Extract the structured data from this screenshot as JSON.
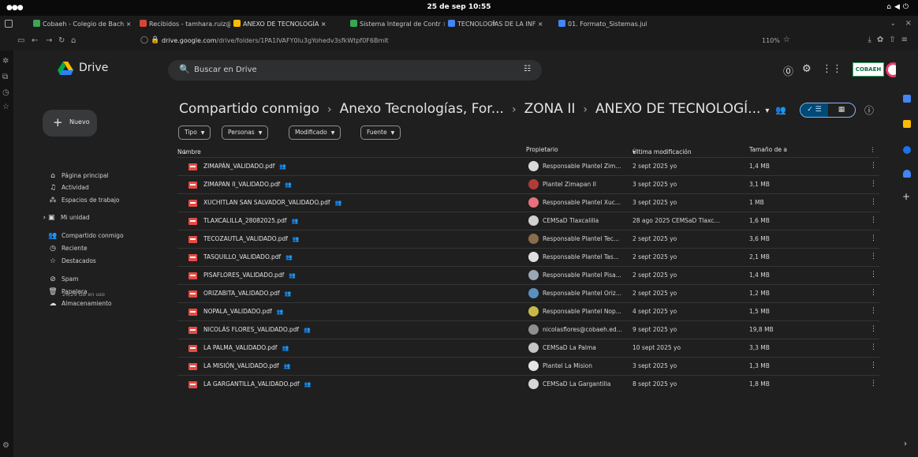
{
  "os": {
    "clock": "25 de sep  10:55"
  },
  "tabs": [
    {
      "label": "Cobaeh - Colegio de Bach ×",
      "color": "#3aa853"
    },
    {
      "label": "Recibidos - tamhara.ruiz@ ×",
      "color": "#d44638"
    },
    {
      "label": "ANEXO DE TECNOLOGÍA ×",
      "color": "#fbbc04"
    },
    {
      "label": "Sistema Integral de Contr ×",
      "color": "#34a853"
    },
    {
      "label": "TECNOLOGÍAS DE LA INF ×",
      "color": "#4285f4"
    },
    {
      "label": "01. Formato_Sistemas.jul ×",
      "color": "#4285f4"
    }
  ],
  "address": {
    "url_host": "drive.google.com",
    "url_path": "/drive/folders/1PA1IVAFY0lu3gYohedv3sfkWtpf0F6Bmlt",
    "zoom": "110%"
  },
  "drive": {
    "app_name": "Drive",
    "search_placeholder": "Buscar en Drive",
    "brand_badge": "COBAEH",
    "new_label": "Nuevo",
    "nav": [
      {
        "icon": "home-icon",
        "glyph": "⌂",
        "label": "Página principal"
      },
      {
        "icon": "bell-icon",
        "glyph": "♫",
        "label": "Actividad"
      },
      {
        "icon": "workspaces-icon",
        "glyph": "⁂",
        "label": "Espacios de trabajo"
      },
      {
        "icon": "my-drive-icon",
        "glyph": "▣",
        "label": "Mi unidad"
      },
      {
        "icon": "shared-icon",
        "glyph": "👥",
        "label": "Compartido conmigo"
      },
      {
        "icon": "clock-icon",
        "glyph": "◷",
        "label": "Reciente"
      },
      {
        "icon": "star-icon",
        "glyph": "☆",
        "label": "Destacados"
      },
      {
        "icon": "spam-icon",
        "glyph": "⊘",
        "label": "Spam"
      },
      {
        "icon": "trash-icon",
        "glyph": "🗑",
        "label": "Papelera"
      },
      {
        "icon": "cloud-icon",
        "glyph": "☁",
        "label": "Almacenamiento"
      }
    ],
    "storage_used": "26,29 GB en uso",
    "breadcrumb": [
      "Compartido conmigo",
      "Anexo Tecnologías, For...",
      "ZONA II",
      "ANEXO DE TECNOLOGÍ..."
    ],
    "filters": [
      "Tipo",
      "Personas",
      "Modificado",
      "Fuente"
    ],
    "columns": {
      "name": "Nombre",
      "owner": "Propietario",
      "modified": "Última modificación",
      "size": "Tamaño de a"
    },
    "files": [
      {
        "name": "ZIMAPÁN_VALIDADO.pdf",
        "owner": "Responsable Plantel Zim...",
        "modified": "2 sept 2025 yo",
        "size": "1,4 MB",
        "avatar_color": "#d9d9d9"
      },
      {
        "name": "ZIMAPAN II_VALIDADO.pdf",
        "owner": "Plantel Zimapan II",
        "modified": "3 sept 2025 yo",
        "size": "3,1 MB",
        "avatar_color": "#b33a3a"
      },
      {
        "name": "XUCHITLAN SAN SALVADOR_VALIDADO.pdf",
        "owner": "Responsable Plantel Xuc...",
        "modified": "3 sept 2025 yo",
        "size": "1 MB",
        "avatar_color": "#e8717d"
      },
      {
        "name": "TLAXCALILLA_28082025.pdf",
        "owner": "CEMSaD Tlaxcalilla",
        "modified": "28 ago 2025 CEMSaD Tlaxc...",
        "size": "1,6 MB",
        "avatar_color": "#d0d0d0"
      },
      {
        "name": "TECOZAUTLA_VALIDADO.pdf",
        "owner": "Responsable Plantel Tec...",
        "modified": "2 sept 2025 yo",
        "size": "3,6 MB",
        "avatar_color": "#8a6d4a"
      },
      {
        "name": "TASQUILLO_VALIDADO.pdf",
        "owner": "Responsable Plantel Tas...",
        "modified": "2 sept 2025 yo",
        "size": "2,1 MB",
        "avatar_color": "#e0e0e0"
      },
      {
        "name": "PISAFLORES_VALIDADO.pdf",
        "owner": "Responsable Plantel Pisa...",
        "modified": "2 sept 2025 yo",
        "size": "1,4 MB",
        "avatar_color": "#9aa7b5"
      },
      {
        "name": "ORIZABITA_VALIDADO.pdf",
        "owner": "Responsable Plantel Oriz...",
        "modified": "2 sept 2025 yo",
        "size": "1,2 MB",
        "avatar_color": "#5a8fc0"
      },
      {
        "name": "NOPALA_VALIDADO.pdf",
        "owner": "Responsable Plantel Nop...",
        "modified": "4 sept 2025 yo",
        "size": "1,5 MB",
        "avatar_color": "#c8b84a"
      },
      {
        "name": "NICOLÁS FLORES_VALIDADO.pdf",
        "owner": "nicolasflores@cobaeh.ed...",
        "modified": "9 sept 2025 yo",
        "size": "19,8 MB",
        "avatar_color": "#8f8f8f"
      },
      {
        "name": "LA PALMA_VALIDADO.pdf",
        "owner": "CEMSaD La Palma",
        "modified": "10 sept 2025 yo",
        "size": "3,3 MB",
        "avatar_color": "#c5c5c5"
      },
      {
        "name": "LA MISIÓN_VALIDADO.pdf",
        "owner": "Plantel La Mision",
        "modified": "3 sept 2025 yo",
        "size": "1,3 MB",
        "avatar_color": "#e6e6e6"
      },
      {
        "name": "LA GARGANTILLA_VALIDADO.pdf",
        "owner": "CEMSaD La Gargantilla",
        "modified": "8 sept 2025 yo",
        "size": "1,8 MB",
        "avatar_color": "#d6d6d6"
      }
    ]
  }
}
